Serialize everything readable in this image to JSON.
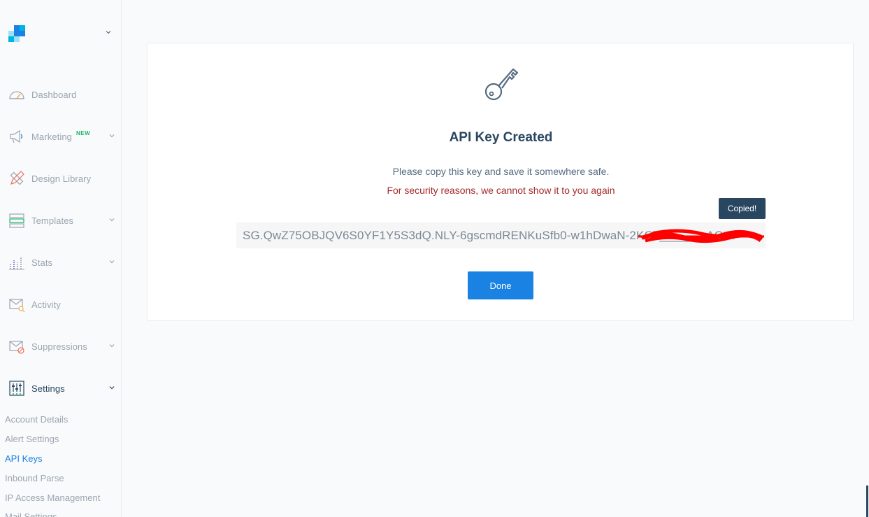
{
  "sidebar": {
    "logo_icon": "sendgrid-logo-icon",
    "nav": [
      {
        "label": "Dashboard",
        "icon": "dashboard-gauge-icon",
        "has_chevron": false
      },
      {
        "label": "Marketing",
        "icon": "megaphone-icon",
        "badge": "NEW",
        "has_chevron": true
      },
      {
        "label": "Design Library",
        "icon": "pencil-ruler-icon",
        "has_chevron": false
      },
      {
        "label": "Templates",
        "icon": "templates-icon",
        "has_chevron": true
      },
      {
        "label": "Stats",
        "icon": "bar-chart-icon",
        "has_chevron": true
      },
      {
        "label": "Activity",
        "icon": "envelope-search-icon",
        "has_chevron": false
      },
      {
        "label": "Suppressions",
        "icon": "envelope-blocked-icon",
        "has_chevron": true
      },
      {
        "label": "Settings",
        "icon": "sliders-icon",
        "has_chevron": true,
        "active": true
      }
    ],
    "settings_sub": [
      {
        "label": "Account Details"
      },
      {
        "label": "Alert Settings"
      },
      {
        "label": "API Keys",
        "active": true
      },
      {
        "label": "Inbound Parse"
      },
      {
        "label": "IP Access Management"
      },
      {
        "label": "Mail Settings"
      }
    ]
  },
  "modal": {
    "icon": "key-icon",
    "title": "API Key Created",
    "message": "Please copy this key and save it somewhere safe.",
    "warning": "For security reasons, we cannot show it to you again",
    "tooltip": "Copied!",
    "api_key": "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",
    "done_label": "Done"
  },
  "colors": {
    "primary": "#1a82e2",
    "navy": "#294661",
    "warning": "#a52a2a",
    "new_badge": "#1ab76b",
    "redaction": "#ff0000"
  }
}
